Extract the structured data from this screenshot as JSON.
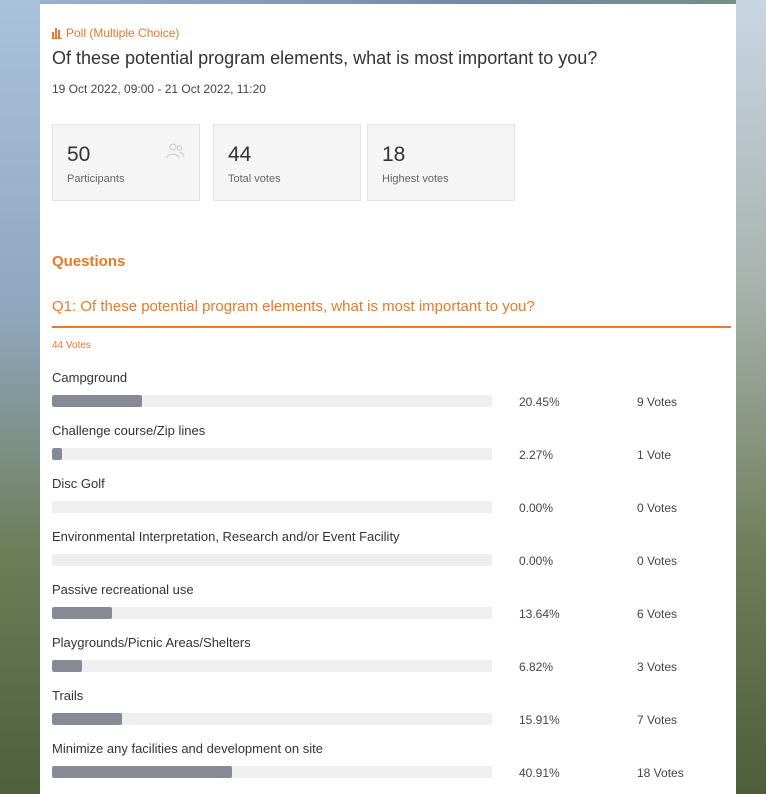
{
  "poll": {
    "type_label": "Poll (Multiple Choice)",
    "title": "Of these potential program elements, what is most important to you?",
    "dates": "19 Oct 2022,  09:00 -  21 Oct 2022,  11:20",
    "accent_color": "#e8792b",
    "bar_color": "#858a94"
  },
  "stats": [
    {
      "value": "50",
      "label": "Participants",
      "icon": "people-icon"
    },
    {
      "value": "44",
      "label": "Total votes"
    },
    {
      "value": "18",
      "label": "Highest votes"
    }
  ],
  "questions_heading": "Questions",
  "question": {
    "title": "Q1: Of these potential program elements, what is most important to you?",
    "votes_label": "44 Votes",
    "options": [
      {
        "label": "Campground",
        "percent_text": "20.45%",
        "votes_text": "9 Votes",
        "percent": 20.45
      },
      {
        "label": "Challenge course/Zip lines",
        "percent_text": "2.27%",
        "votes_text": "1 Vote",
        "percent": 2.27
      },
      {
        "label": "Disc Golf",
        "percent_text": "0.00%",
        "votes_text": "0 Votes",
        "percent": 0
      },
      {
        "label": "Environmental Interpretation, Research and/or Event Facility",
        "percent_text": "0.00%",
        "votes_text": "0 Votes",
        "percent": 0
      },
      {
        "label": "Passive recreational use",
        "percent_text": "13.64%",
        "votes_text": "6 Votes",
        "percent": 13.64
      },
      {
        "label": "Playgrounds/Picnic Areas/Shelters",
        "percent_text": "6.82%",
        "votes_text": "3 Votes",
        "percent": 6.82
      },
      {
        "label": "Trails",
        "percent_text": "15.91%",
        "votes_text": "7 Votes",
        "percent": 15.91
      },
      {
        "label": "Minimize any facilities and development on site",
        "percent_text": "40.91%",
        "votes_text": "18 Votes",
        "percent": 40.91
      }
    ]
  }
}
